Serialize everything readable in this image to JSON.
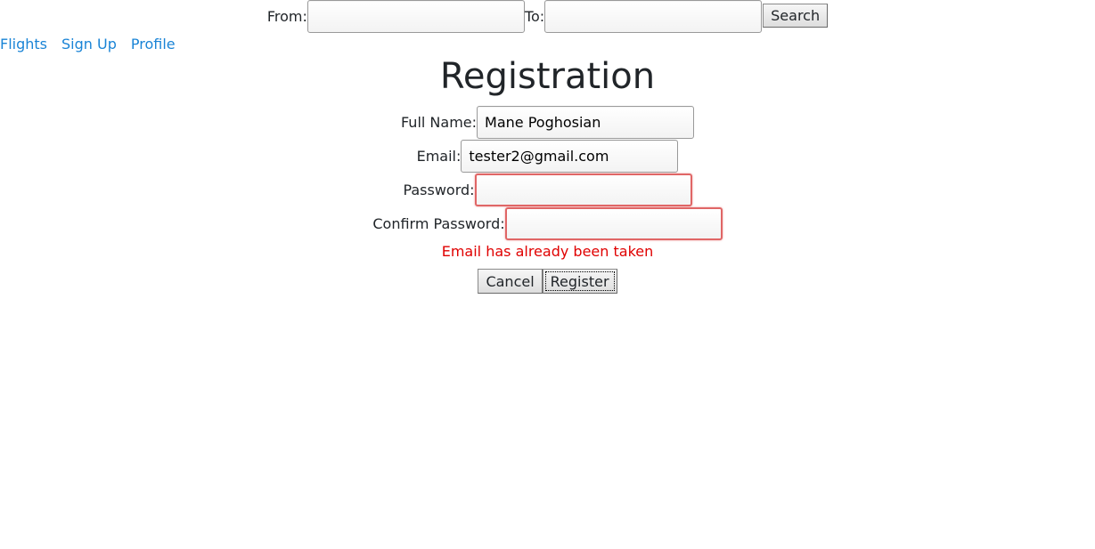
{
  "search": {
    "from_label": "From:",
    "from_value": "",
    "to_label": "To:",
    "to_value": "",
    "search_button": "Search"
  },
  "nav": {
    "items": [
      {
        "label": "Flights"
      },
      {
        "label": "Sign Up"
      },
      {
        "label": "Profile"
      }
    ],
    "link_color": "#1a84d6"
  },
  "page": {
    "title": "Registration"
  },
  "form": {
    "full_name_label": "Full Name:",
    "full_name_value": "Mane Poghosian",
    "email_label": "Email:",
    "email_value": "tester2@gmail.com",
    "password_label": "Password:",
    "password_value": "",
    "confirm_password_label": "Confirm Password:",
    "confirm_password_value": "",
    "error_message": "Email has already been taken",
    "error_color": "#e00000",
    "cancel_button": "Cancel",
    "register_button": "Register"
  }
}
